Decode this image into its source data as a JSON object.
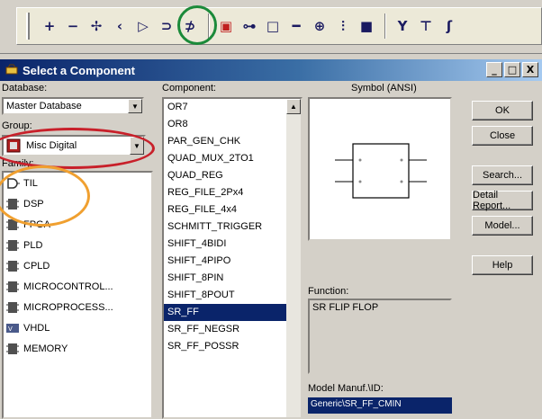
{
  "toolbar": {
    "buttons": [
      {
        "name": "source-plus-icon",
        "glyph": "+"
      },
      {
        "name": "minus-icon",
        "glyph": "−"
      },
      {
        "name": "multi-icon",
        "glyph": "✢"
      },
      {
        "name": "less-icon",
        "glyph": "‹"
      },
      {
        "name": "diode-icon",
        "glyph": "▷"
      },
      {
        "name": "transistor-icon",
        "glyph": "⊃"
      },
      {
        "name": "ttl-icon",
        "glyph": "⊅"
      },
      {
        "name": "misc-digital-icon",
        "glyph": "▣"
      },
      {
        "name": "mixed-icon",
        "glyph": "⊶"
      },
      {
        "name": "indicator-icon",
        "glyph": "□"
      },
      {
        "name": "power-icon",
        "glyph": "━"
      },
      {
        "name": "misc-icon",
        "glyph": "⊕"
      },
      {
        "name": "rf-icon",
        "glyph": "⫶"
      },
      {
        "name": "electromech-icon",
        "glyph": "■"
      },
      {
        "name": "antenna-icon",
        "glyph": "Y"
      },
      {
        "name": "ladder-icon",
        "glyph": "⊤"
      },
      {
        "name": "hier-icon",
        "glyph": "ʃ"
      }
    ]
  },
  "dialog": {
    "title": "Select a Component",
    "window_buttons": {
      "minimize": "_",
      "maximize": "□",
      "close": "X"
    },
    "database_label": "Database:",
    "database_value": "Master Database",
    "group_label": "Group:",
    "group_value": "Misc Digital",
    "family_label": "Family:",
    "families": [
      {
        "label": "TIL",
        "icon": "ttl-gate-icon"
      },
      {
        "label": "DSP",
        "icon": "chip-icon"
      },
      {
        "label": "FPGA",
        "icon": "chip-icon"
      },
      {
        "label": "PLD",
        "icon": "chip-icon"
      },
      {
        "label": "CPLD",
        "icon": "chip-icon"
      },
      {
        "label": "MICROCONTROL...",
        "icon": "chip-icon"
      },
      {
        "label": "MICROPROCESS...",
        "icon": "chip-icon"
      },
      {
        "label": "VHDL",
        "icon": "vhdl-icon"
      },
      {
        "label": "MEMORY",
        "icon": "chip-icon"
      }
    ],
    "component_label": "Component:",
    "components": [
      "OR7",
      "OR8",
      "PAR_GEN_CHK",
      "QUAD_MUX_2TO1",
      "QUAD_REG",
      "REG_FILE_2Px4",
      "REG_FILE_4x4",
      "SCHMITT_TRIGGER",
      "SHIFT_4BIDI",
      "SHIFT_4PIPO",
      "SHIFT_8PIN",
      "SHIFT_8POUT",
      "SR_FF",
      "SR_FF_NEGSR",
      "SR_FF_POSSR"
    ],
    "selected_component": "SR_FF",
    "symbol_label": "Symbol (ANSI)",
    "function_label": "Function:",
    "function_value": "SR FLIP FLOP",
    "model_label": "Model Manuf.\\ID:",
    "model_value": "Generic\\SR_FF_CMIN",
    "buttons": {
      "ok": "OK",
      "close": "Close",
      "search": "Search...",
      "detail_report": "Detail Report...",
      "model": "Model...",
      "help": "Help"
    }
  },
  "colors": {
    "highlight_green": "#1b8a3a",
    "highlight_red": "#c8202a",
    "highlight_orange": "#f0a030",
    "selection": "#0a246a"
  }
}
